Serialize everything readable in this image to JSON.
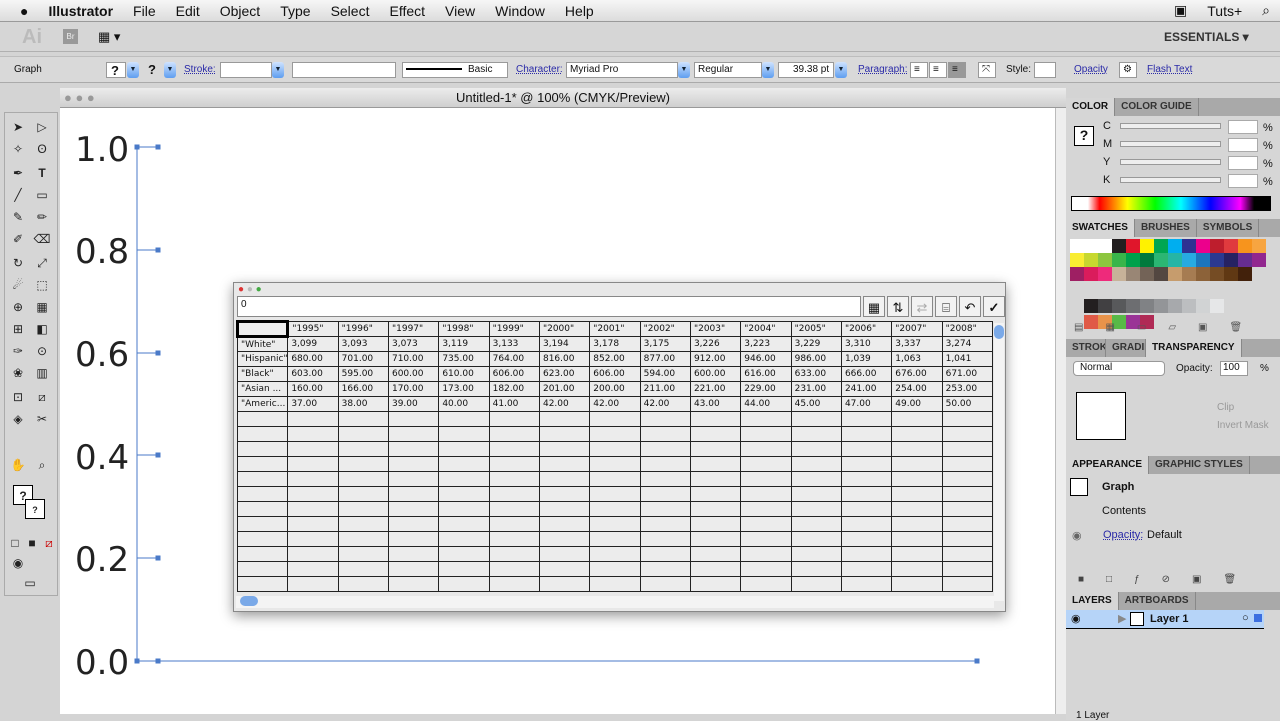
{
  "menubar": {
    "apple": "",
    "app": "Illustrator",
    "items": [
      "File",
      "Edit",
      "Object",
      "Type",
      "Select",
      "Effect",
      "View",
      "Window",
      "Help"
    ],
    "right": "Tuts+"
  },
  "appbar": {
    "logo": "Ai",
    "bridge": "Br",
    "workspace": "ESSENTIALS ▾"
  },
  "control": {
    "selection": "Graph",
    "stroke": "Stroke:",
    "brush": "Basic",
    "character": "Character:",
    "font": "Myriad Pro",
    "style": "Regular",
    "size": "39.38 pt",
    "paragraph": "Paragraph:",
    "style_label": "Style:",
    "opacity": "Opacity",
    "flash": "Flash Text"
  },
  "document": {
    "title": "Untitled-1* @ 100% (CMYK/Preview)"
  },
  "graph": {
    "y_ticks": [
      "1.0",
      "0.8",
      "0.6",
      "0.4",
      "0.2",
      "0.0"
    ]
  },
  "data_dialog": {
    "cell_value": "0",
    "headers": [
      "",
      "\"1995\"",
      "\"1996\"",
      "\"1997\"",
      "\"1998\"",
      "\"1999\"",
      "\"2000\"",
      "\"2001\"",
      "\"2002\"",
      "\"2003\"",
      "\"2004\"",
      "\"2005\"",
      "\"2006\"",
      "\"2007\"",
      "\"2008\""
    ],
    "rows": [
      [
        "\"White\"",
        "3,099",
        "3,093",
        "3,073",
        "3,119",
        "3,133",
        "3,194",
        "3,178",
        "3,175",
        "3,226",
        "3,223",
        "3,229",
        "3,310",
        "3,337",
        "3,274"
      ],
      [
        "\"Hispanic\"",
        "680.00",
        "701.00",
        "710.00",
        "735.00",
        "764.00",
        "816.00",
        "852.00",
        "877.00",
        "912.00",
        "946.00",
        "986.00",
        "1,039",
        "1,063",
        "1,041"
      ],
      [
        "\"Black\"",
        "603.00",
        "595.00",
        "600.00",
        "610.00",
        "606.00",
        "623.00",
        "606.00",
        "594.00",
        "600.00",
        "616.00",
        "633.00",
        "666.00",
        "676.00",
        "671.00"
      ],
      [
        "\"Asian ...",
        "160.00",
        "166.00",
        "170.00",
        "173.00",
        "182.00",
        "201.00",
        "200.00",
        "211.00",
        "221.00",
        "229.00",
        "231.00",
        "241.00",
        "254.00",
        "253.00"
      ],
      [
        "\"Americ...",
        "37.00",
        "38.00",
        "39.00",
        "40.00",
        "41.00",
        "42.00",
        "42.00",
        "42.00",
        "43.00",
        "44.00",
        "45.00",
        "47.00",
        "49.00",
        "50.00"
      ]
    ]
  },
  "color_panel": {
    "tabs": [
      "COLOR",
      "COLOR GUIDE"
    ],
    "channels": [
      "C",
      "M",
      "Y",
      "K"
    ],
    "unit": "%"
  },
  "swatches_panel": {
    "tabs": [
      "SWATCHES",
      "BRUSHES",
      "SYMBOLS"
    ],
    "colors": [
      "#ffffff",
      "#ffffff",
      "#ffffff",
      "#231f20",
      "#e0162b",
      "#fff200",
      "#00a651",
      "#00aeef",
      "#2e3192",
      "#ec008c",
      "#be1e2d",
      "#e03a3e",
      "#f7941d",
      "#f7a541",
      "#f9ed32",
      "#c7d82f",
      "#8dc63f",
      "#39b54a",
      "#00a14b",
      "#007a3d",
      "#2bb673",
      "#26b5a5",
      "#27aae1",
      "#1c75bc",
      "#2b3990",
      "#262262",
      "#662d91",
      "#92278f",
      "#9e1f63",
      "#da1c5c",
      "#ee2a7b",
      "#c7b299",
      "#998675",
      "#736357",
      "#534741",
      "#c69c6d",
      "#a67c52",
      "#8c6239",
      "#754c24",
      "#603813",
      "#42210b"
    ],
    "grays": [
      "#231f20",
      "#414042",
      "#58595b",
      "#6d6e71",
      "#808285",
      "#939598",
      "#a7a9ac",
      "#bcbec0",
      "#d1d3d4",
      "#e6e7e8"
    ],
    "group2": [
      "#e05a47",
      "#e8934a",
      "#58b947",
      "#9a3396",
      "#b02a55"
    ]
  },
  "transparency_panel": {
    "tabs": [
      "STROKE",
      "GRADIENT",
      "TRANSPARENCY"
    ],
    "mode": "Normal",
    "opacity_label": "Opacity:",
    "opacity": "100",
    "unit": "%",
    "clip": "Clip",
    "invert": "Invert Mask"
  },
  "appearance_panel": {
    "tabs": [
      "APPEARANCE",
      "GRAPHIC STYLES"
    ],
    "object": "Graph",
    "contents": "Contents",
    "opacity_label": "Opacity:",
    "opacity_value": "Default"
  },
  "layers_panel": {
    "tabs": [
      "LAYERS",
      "ARTBOARDS"
    ],
    "layer": "Layer 1",
    "count": "1 Layer"
  }
}
